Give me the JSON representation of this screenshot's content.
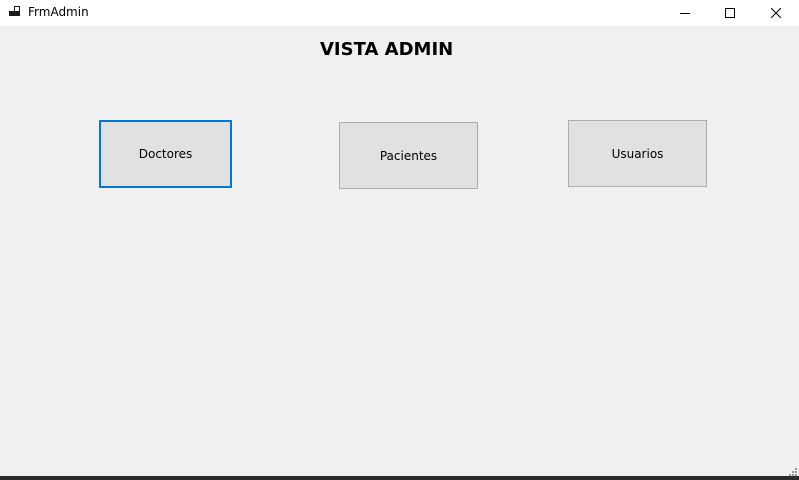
{
  "window": {
    "title": "FrmAdmin",
    "icon": "form-icon",
    "controls": {
      "minimize_icon": "minimize-icon",
      "maximize_icon": "maximize-icon",
      "close_icon": "close-icon"
    }
  },
  "form": {
    "heading": "VISTA ADMIN",
    "buttons": [
      {
        "label": "Doctores",
        "focused": true
      },
      {
        "label": "Pacientes",
        "focused": false
      },
      {
        "label": "Usuarios",
        "focused": false
      }
    ]
  },
  "colors": {
    "background": "#f0f0f0",
    "titlebar": "#ffffff",
    "button_face": "#e1e1e1",
    "button_border": "#adadad",
    "focus_border": "#0078d7"
  }
}
